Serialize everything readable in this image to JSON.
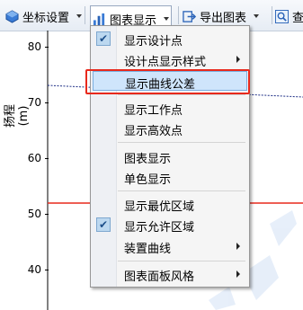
{
  "toolbar": {
    "coord_settings": "坐标设置",
    "chart_display": "图表显示",
    "export_chart": "导出图表",
    "cut_text": "查"
  },
  "chart": {
    "ylabel": "扬程(m)",
    "yticks": [
      "80",
      "70",
      "60",
      "50",
      "40"
    ]
  },
  "menu": {
    "items": [
      {
        "label": "显示设计点",
        "checked": true
      },
      {
        "label": "设计点显示样式",
        "submenu": true
      },
      {
        "label": "显示曲线公差",
        "highlighted": true
      },
      {
        "label": "显示工作点"
      },
      {
        "label": "显示高效点"
      },
      {
        "label": "图表显示"
      },
      {
        "label": "单色显示"
      },
      {
        "label": "显示最优区域"
      },
      {
        "label": "显示允许区域",
        "checked": true
      },
      {
        "label": "装置曲线",
        "submenu": true
      },
      {
        "label": "图表面板风格",
        "submenu": true
      }
    ]
  },
  "colors": {
    "accent_red": "#e8291c",
    "curve_blue": "#1f2f86",
    "highlight": "#cfe5fb"
  }
}
